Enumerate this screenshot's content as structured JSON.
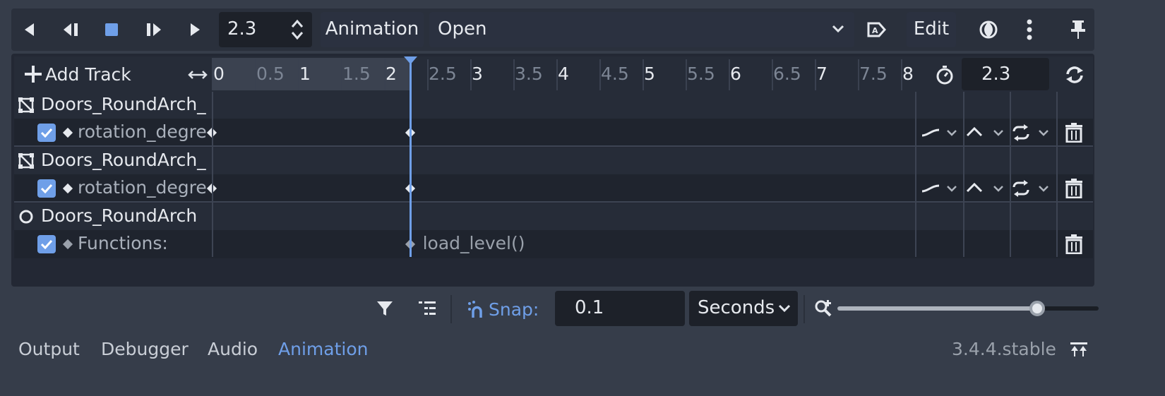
{
  "toolbar": {
    "current_time": "2.3",
    "animation_menu_label": "Animation",
    "selected_animation": "Open",
    "edit_menu_label": "Edit"
  },
  "track_header": {
    "add_track_label": "Add Track",
    "ruler": [
      {
        "label": "0",
        "kind": "major"
      },
      {
        "label": "0.5",
        "kind": "minor"
      },
      {
        "label": "1",
        "kind": "major"
      },
      {
        "label": "1.5",
        "kind": "minor"
      },
      {
        "label": "2",
        "kind": "major"
      },
      {
        "label": "2.5",
        "kind": "minor"
      },
      {
        "label": "3",
        "kind": "major"
      },
      {
        "label": "3.5",
        "kind": "minor"
      },
      {
        "label": "4",
        "kind": "major"
      },
      {
        "label": "4.5",
        "kind": "minor"
      },
      {
        "label": "5",
        "kind": "major"
      },
      {
        "label": "5.5",
        "kind": "minor"
      },
      {
        "label": "6",
        "kind": "major"
      },
      {
        "label": "6.5",
        "kind": "minor"
      },
      {
        "label": "7",
        "kind": "major"
      },
      {
        "label": "7.5",
        "kind": "minor"
      },
      {
        "label": "8",
        "kind": "major"
      }
    ],
    "length": "2.3",
    "playhead_time": 2.3
  },
  "tracks": [
    {
      "node_name": "Doors_RoundArch_",
      "node_icon": "spatial-node-icon",
      "property": "rotation_degre",
      "enabled": true,
      "keyframe_times": [
        0,
        2.3
      ]
    },
    {
      "node_name": "Doors_RoundArch_",
      "node_icon": "spatial-node-icon",
      "property": "rotation_degre",
      "enabled": true,
      "keyframe_times": [
        0,
        2.3
      ]
    },
    {
      "node_name": "Doors_RoundArch",
      "node_icon": "circle-node-icon",
      "property": "Functions:",
      "enabled": true,
      "keyframe_times": [
        2.3
      ],
      "keyframe_label": "load_level()"
    }
  ],
  "bottom_bar": {
    "snap_label": "Snap:",
    "snap_value": "0.1",
    "snap_unit": "Seconds",
    "zoom_level": 0.85
  },
  "status": {
    "tabs": [
      "Output",
      "Debugger",
      "Audio",
      "Animation"
    ],
    "active_tab": "Animation",
    "version": "3.4.4.stable"
  },
  "colors": {
    "accent": "#6f9fe8",
    "playhead": "#6f9fe8",
    "panel_bg": "#232834",
    "editor_bg": "#363d4a"
  }
}
